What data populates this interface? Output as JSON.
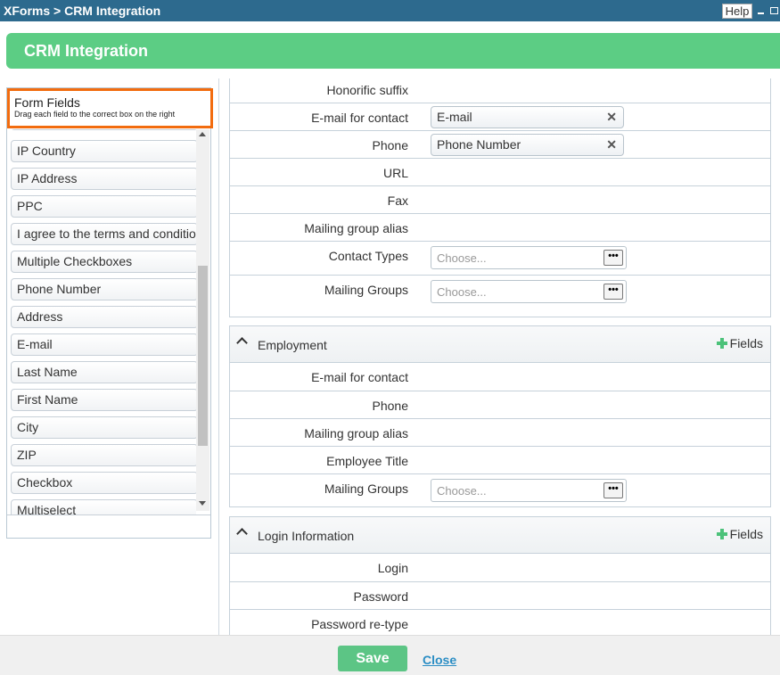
{
  "window": {
    "title": "XForms > CRM Integration",
    "help_label": "Help"
  },
  "banner": {
    "title": "CRM Integration"
  },
  "form_fields": {
    "title": "Form Fields",
    "hint": "Drag each field to the correct box on the right",
    "items": [
      "IP Country",
      "IP Address",
      "PPC",
      "I agree to the terms and conditions",
      "Multiple Checkboxes",
      "Phone Number",
      "Address",
      "E-mail",
      "Last Name",
      "First Name",
      "City",
      "ZIP",
      "Checkbox",
      "Multiselect"
    ]
  },
  "contact_section": {
    "rows": [
      {
        "label": "Honorific suffix"
      },
      {
        "label": "E-mail for contact",
        "token": "E-mail"
      },
      {
        "label": "Phone",
        "token": "Phone Number"
      },
      {
        "label": "URL"
      },
      {
        "label": "Fax"
      },
      {
        "label": "Mailing group alias"
      },
      {
        "label": "Contact Types",
        "placeholder": "Choose..."
      },
      {
        "label": "Mailing Groups",
        "placeholder": "Choose..."
      }
    ]
  },
  "employment_section": {
    "title": "Employment",
    "add_fields_label": "Fields",
    "rows": [
      {
        "label": "E-mail for contact"
      },
      {
        "label": "Phone"
      },
      {
        "label": "Mailing group alias"
      },
      {
        "label": "Employee Title"
      },
      {
        "label": "Mailing Groups",
        "placeholder": "Choose..."
      }
    ]
  },
  "login_section": {
    "title": "Login Information",
    "add_fields_label": "Fields",
    "rows": [
      {
        "label": "Login"
      },
      {
        "label": "Password"
      },
      {
        "label": "Password re-type"
      }
    ]
  },
  "footer": {
    "save_label": "Save",
    "close_label": "Close"
  },
  "icons": {
    "remove": "close-icon",
    "add": "plus-icon",
    "collapse": "chevron-up-icon",
    "browse": "ellipsis-icon"
  },
  "colors": {
    "titlebar": "#2d6a8e",
    "banner": "#5ccd84",
    "highlight": "#f26c0f",
    "save": "#5cc585",
    "link": "#2a8dc4"
  }
}
